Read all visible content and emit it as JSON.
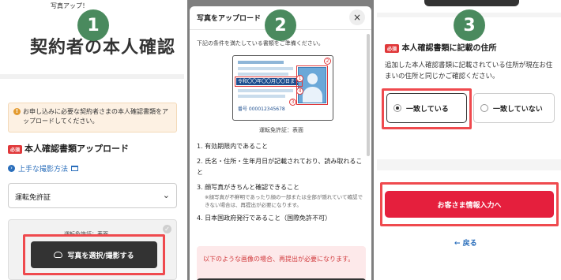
{
  "steps": [
    "1",
    "2",
    "3"
  ],
  "panel1": {
    "top_text": "写真アップ！",
    "title": "契約者の本人確認",
    "notice_icon": "!",
    "notice": "お申し込みに必要な契約者さまの本人確認書類をアップロードしてください。",
    "required_tag": "必須",
    "section_title": "本人確認書類アップロード",
    "photo_tips_link": "上手な撮影方法",
    "document_select": {
      "value": "運転免許証",
      "icon": "chevron-down-icon"
    },
    "upload_label": "運転免許証：表面",
    "upload_button": "写真を選択/撮影する"
  },
  "panel2": {
    "modal_title": "写真をアップロード",
    "close_label": "×",
    "intro": "下記の条件を満たしている書類をご準備ください。",
    "license": {
      "band_text": "令和〇〇年〇〇月〇〇日まで有効",
      "number": "番号 000012345678",
      "marks": [
        "1",
        "2",
        "3",
        "4"
      ]
    },
    "caption": "運転免許証：表面",
    "conditions": [
      {
        "text": "1. 有効期限内であること",
        "sub": ""
      },
      {
        "text": "2. 氏名・住所・生年月日が記載されており、読み取れること",
        "sub": ""
      },
      {
        "text": "3. 顔写真がきちんと確認できること",
        "sub": "※顔写真が不鮮明であったり顔の一部または全部が隠れていて確認できない場合は、再提出が必要になります。"
      },
      {
        "text": "4. 日本国政府発行であること（国際免許不可）",
        "sub": ""
      }
    ],
    "warning": "以下のような画像の場合、再提出が必要になります。"
  },
  "panel3": {
    "required_tag": "必須",
    "section_title": "本人確認書類に記載の住所",
    "description": "追加した本人確認書類に記載されている住所が現在お住まいの住所と同じかご確認ください。",
    "option_match": "一致している",
    "option_no_match": "一致していない",
    "selected": "一致している",
    "cta": "お客さま情報入力へ",
    "back": "← 戻る"
  },
  "colors": {
    "badge": "#4a8a5e",
    "highlight": "#ef4a4e",
    "cta": "#e51f3d",
    "link": "#2a6ebb"
  }
}
